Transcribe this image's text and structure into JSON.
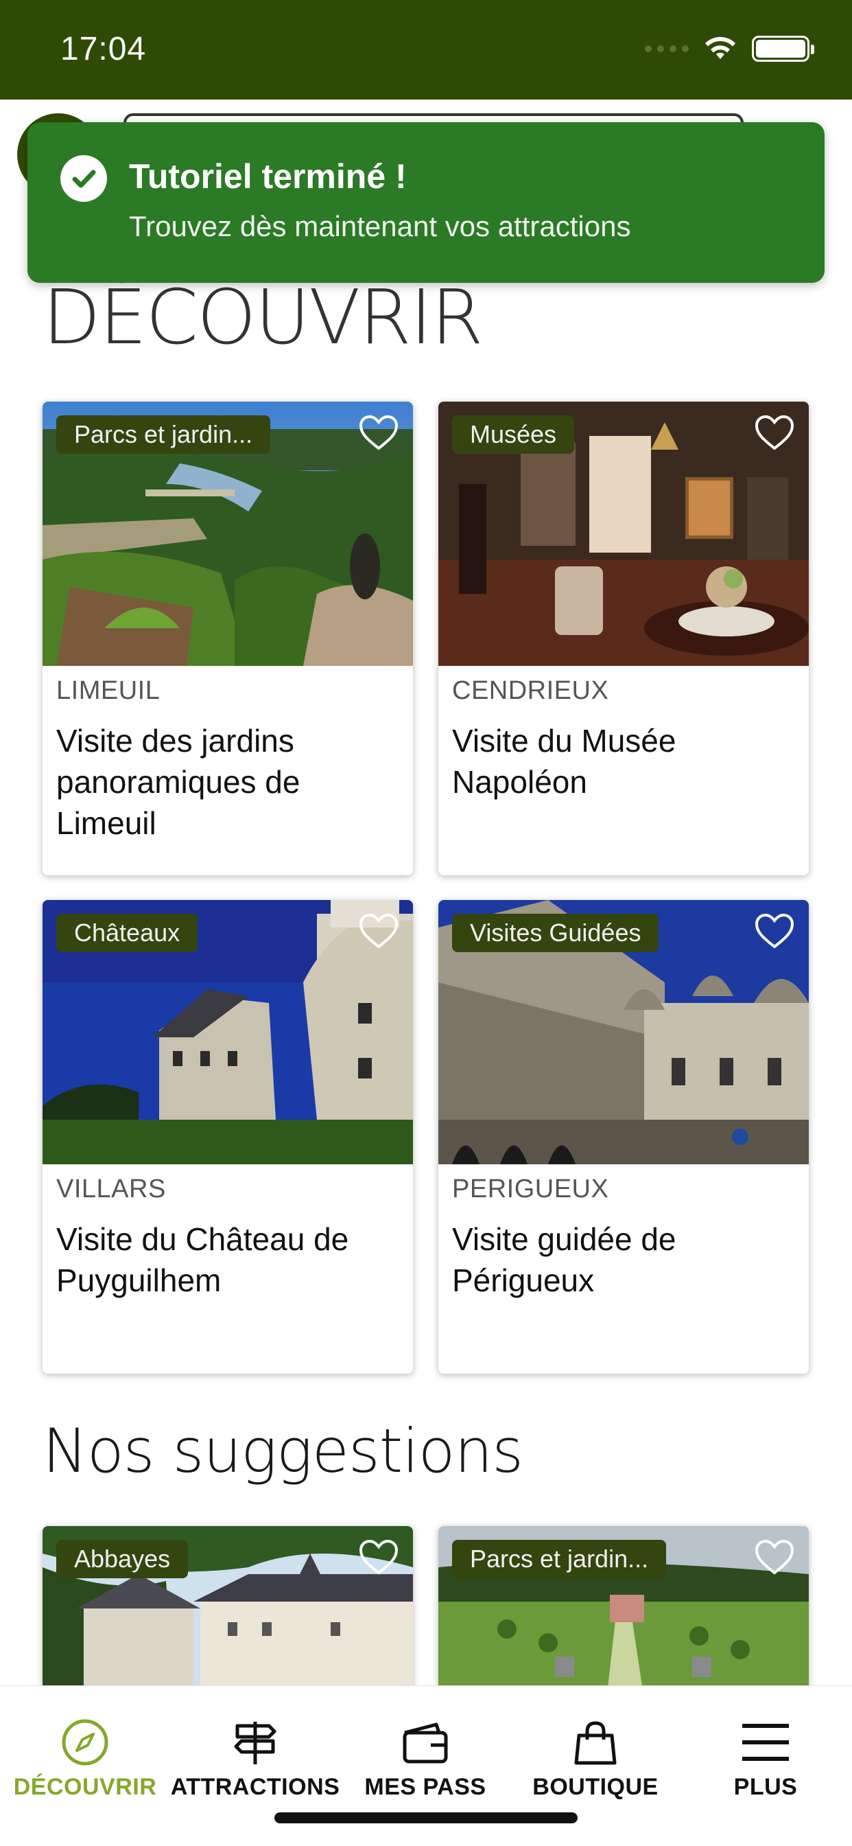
{
  "status_bar": {
    "time": "17:04"
  },
  "toast": {
    "title": "Tutoriel terminé !",
    "subtitle": "Trouvez dès maintenant vos attractions"
  },
  "sections": {
    "discover_title": "DÉCOUVRIR",
    "suggestions_title": "Nos suggestions"
  },
  "discover_cards": [
    {
      "tag": "Parcs et jardin...",
      "city": "LIMEUIL",
      "title": "Visite des jardins panoramiques de Limeuil"
    },
    {
      "tag": "Musées",
      "city": "CENDRIEUX",
      "title": "Visite du Musée Napoléon"
    },
    {
      "tag": "Châteaux",
      "city": "VILLARS",
      "title": "Visite du Château de Puyguilhem"
    },
    {
      "tag": "Visites Guidées",
      "city": "PERIGUEUX",
      "title": "Visite guidée de Périgueux"
    }
  ],
  "suggestion_cards": [
    {
      "tag": "Abbayes"
    },
    {
      "tag": "Parcs et jardin..."
    }
  ],
  "tab_bar": {
    "items": [
      {
        "label": "DÉCOUVRIR",
        "icon": "compass-icon",
        "active": true
      },
      {
        "label": "ATTRACTIONS",
        "icon": "signpost-icon",
        "active": false
      },
      {
        "label": "MES PASS",
        "icon": "wallet-icon",
        "active": false
      },
      {
        "label": "BOUTIQUE",
        "icon": "shopping-bag-icon",
        "active": false
      },
      {
        "label": "PLUS",
        "icon": "menu-icon",
        "active": false
      }
    ]
  },
  "colors": {
    "brand_dark": "#2f4a05",
    "toast_green": "#2b7a25",
    "tag_bg": "#34450f",
    "active_tab": "#86a82c"
  }
}
